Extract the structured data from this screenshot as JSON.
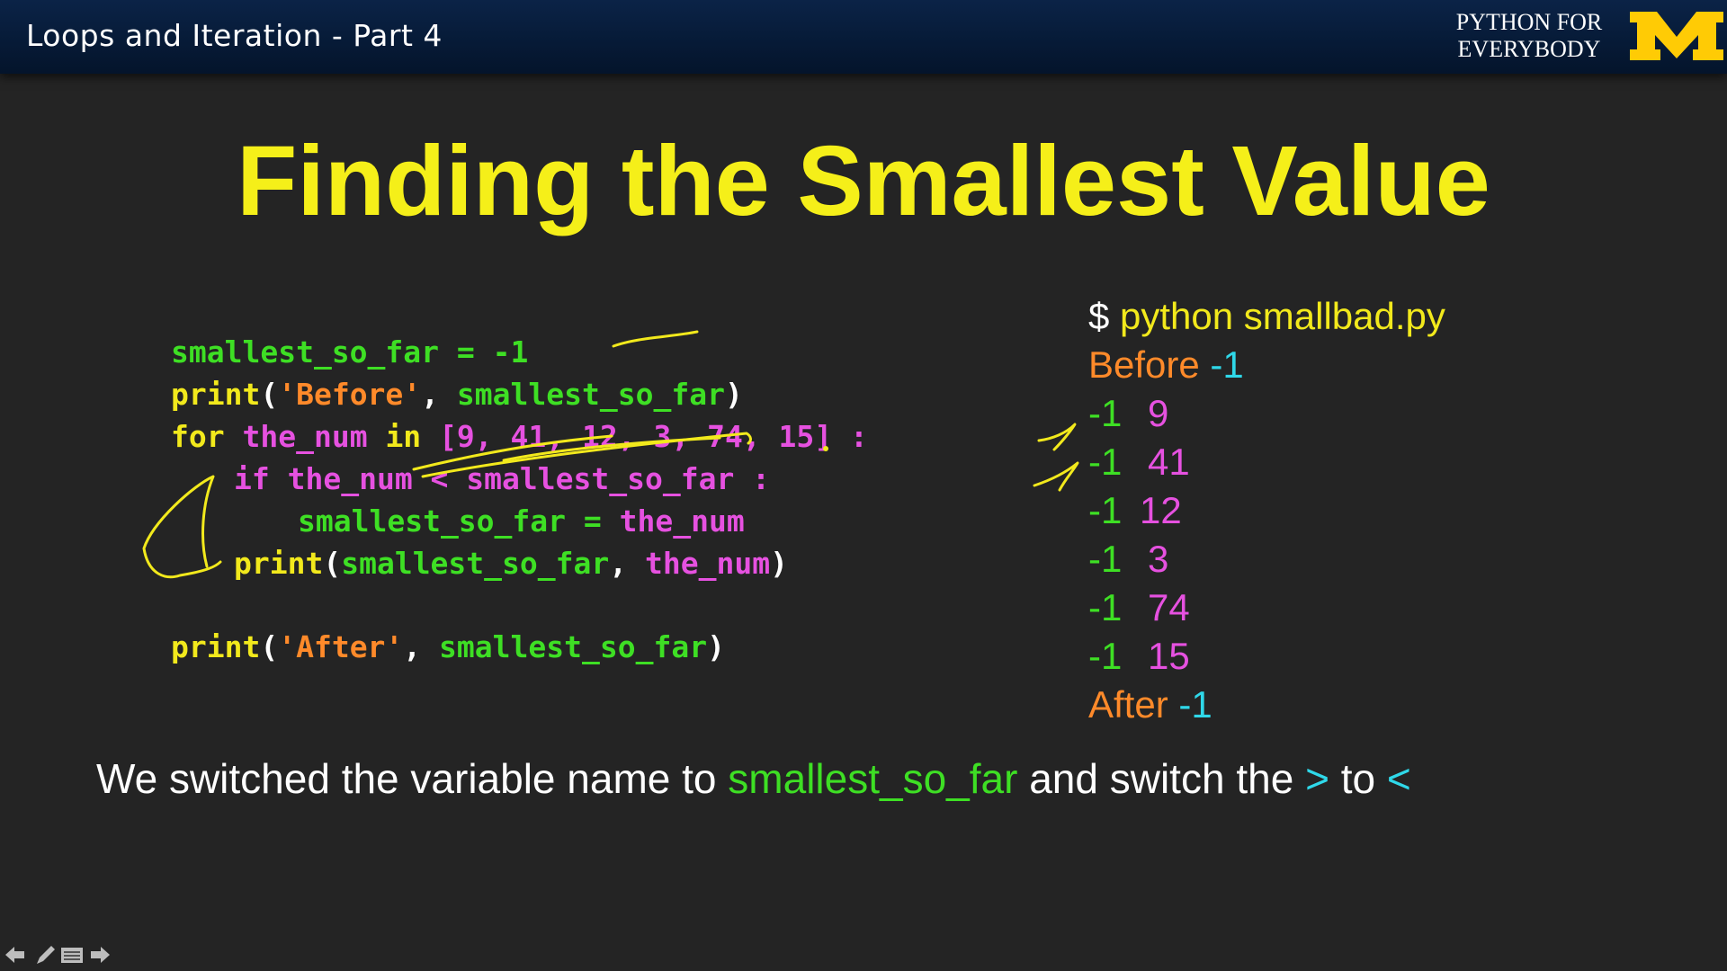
{
  "header": {
    "course_title": "Loops and Iteration - Part 4",
    "brand_line1": "PYTHON FOR",
    "brand_line2": "EVERYBODY",
    "logo_icon": "michigan-block-m-icon",
    "logo_color": "#ffcb05"
  },
  "slide": {
    "title": "Finding the Smallest Value",
    "code": {
      "line1": {
        "var": "smallest_so_far",
        "op": " = ",
        "val": "-1"
      },
      "line2": {
        "fn": "print",
        "open": "(",
        "str": "'Before'",
        "comma": ", ",
        "arg": "smallest_so_far",
        "close": ")"
      },
      "line3": {
        "kw_for": "for",
        "sp1": " ",
        "var": "the_num",
        "sp2": " ",
        "kw_in": "in",
        "sp3": " ",
        "list": "[9, 41, 12, 3, 74, 15]",
        "colon": " :"
      },
      "line4": {
        "kw_if": "if",
        "cond": " the_num < smallest_so_far :"
      },
      "line5": {
        "lhs": "smallest_so_far",
        "op": " = ",
        "rhs": "the_num"
      },
      "line6": {
        "fn": "print",
        "open": "(",
        "arg1": "smallest_so_far",
        "comma": ", ",
        "arg2": "the_num",
        "close": ")"
      },
      "line7": {
        "fn": "print",
        "open": "(",
        "str": "'After'",
        "comma": ", ",
        "arg": "smallest_so_far",
        "close": ")"
      }
    },
    "output": {
      "command_prompt": "$ ",
      "command": "python smallbad.py",
      "before_label": "Before",
      "before_value": " -1",
      "rows": [
        {
          "a": "-1",
          "b": "9"
        },
        {
          "a": "-1",
          "b": "41"
        },
        {
          "a": "-1",
          "b": "12"
        },
        {
          "a": "-1",
          "b": "3"
        },
        {
          "a": "-1",
          "b": "74"
        },
        {
          "a": "-1",
          "b": "15"
        }
      ],
      "after_label": "After",
      "after_value": " -1"
    },
    "footnote": {
      "part1": "We switched the variable name to ",
      "part2": "smallest_so_far",
      "part3": " and switch the ",
      "part4": ">",
      "part5": " to ",
      "part6": "<"
    }
  },
  "colors": {
    "title": "#f5ef19",
    "green": "#3edf24",
    "yellow": "#f2e91c",
    "orange": "#ff8a2a",
    "magenta": "#e651e0",
    "cyan": "#2fd8e9",
    "annotation": "#f2e91c"
  },
  "controls": {
    "icons": [
      "arrow-left-icon",
      "pen-icon",
      "menu-icon",
      "arrow-right-icon"
    ]
  }
}
